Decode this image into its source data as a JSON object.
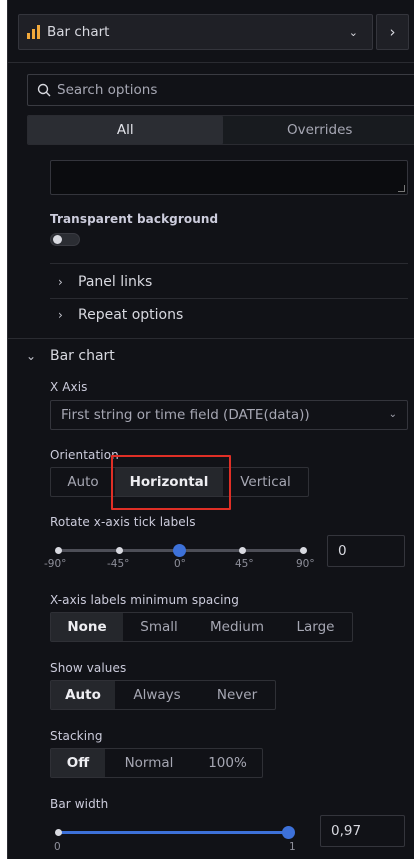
{
  "header": {
    "viz_name": "Bar chart",
    "picker_chevron_icon": "chevron-down-icon",
    "next_icon": "chevron-right-icon"
  },
  "search": {
    "placeholder": "Search options"
  },
  "tabs": [
    {
      "label": "All",
      "active": true
    },
    {
      "label": "Overrides",
      "active": false
    }
  ],
  "panel_options": {
    "transparent_label": "Transparent background",
    "transparent_on": false,
    "panel_links": "Panel links",
    "repeat_options": "Repeat options"
  },
  "bar_chart": {
    "section_title": "Bar chart",
    "x_axis_label": "X Axis",
    "x_axis_value": "First string or time field (DATE(data))",
    "orientation_label": "Orientation",
    "orientation_options": [
      "Auto",
      "Horizontal",
      "Vertical"
    ],
    "orientation_selected": "Horizontal",
    "rotate_label": "Rotate x-axis tick labels",
    "rotate_ticks": [
      "-90°",
      "-45°",
      "0°",
      "45°",
      "90°"
    ],
    "rotate_value": "0",
    "spacing_label": "X-axis labels minimum spacing",
    "spacing_options": [
      "None",
      "Small",
      "Medium",
      "Large"
    ],
    "spacing_selected": "None",
    "show_values_label": "Show values",
    "show_values_options": [
      "Auto",
      "Always",
      "Never"
    ],
    "show_values_selected": "Auto",
    "stacking_label": "Stacking",
    "stacking_options": [
      "Off",
      "Normal",
      "100%"
    ],
    "stacking_selected": "Off",
    "bar_width_label": "Bar width",
    "bar_width_min": "0",
    "bar_width_max": "1",
    "bar_width_value": "0,97"
  },
  "colors": {
    "accent": "#3d71d9",
    "highlight": "#e02f26",
    "viz_icon": "#f2a93b"
  }
}
